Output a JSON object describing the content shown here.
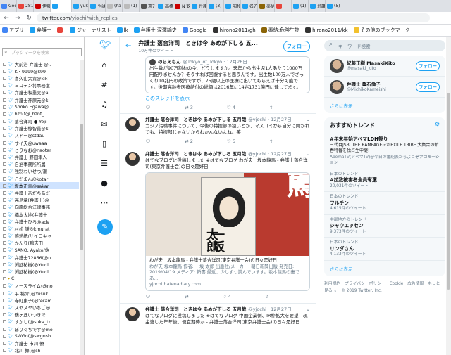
{
  "tabs": [
    {
      "label": "Goo",
      "color": "#4285f4"
    },
    {
      "label": "281",
      "color": "#e8453c"
    },
    {
      "label": "伊藤",
      "color": "#cc0000"
    },
    {
      "label": "",
      "color": "#1da1f2"
    },
    {
      "label": "yuk",
      "color": "#1da1f2"
    },
    {
      "label": "やは",
      "color": "#1da1f2"
    },
    {
      "label": "(ha",
      "color": "#bbb"
    },
    {
      "label": "(1)",
      "color": "#bbb"
    },
    {
      "label": "京7",
      "color": "#555"
    },
    {
      "label": "高橋",
      "color": "#1da1f2"
    },
    {
      "label": "N 飲食",
      "color": "#cc0000"
    },
    {
      "label": "弁護",
      "color": "#1da1f2"
    },
    {
      "label": "(3)",
      "color": "#1da1f2"
    },
    {
      "label": "昭和",
      "color": "#1da1f2"
    },
    {
      "label": "名方",
      "color": "#1da1f2"
    },
    {
      "label": "奉納",
      "color": "#8b6508"
    },
    {
      "label": "",
      "color": "#e8453c"
    },
    {
      "label": "(1)",
      "color": "#1da1f2"
    },
    {
      "label": "弁護",
      "color": "#1da1f2"
    },
    {
      "label": "(5)",
      "color": "#1da1f2"
    }
  ],
  "address": {
    "host": "twitter.com",
    "path": "/yjochi/with_replies"
  },
  "bookmarks": [
    {
      "label": "アプリ",
      "color": "#4285f4"
    },
    {
      "label": "弁護士",
      "color": "#1da1f2"
    },
    {
      "label": "",
      "color": "#e8453c"
    },
    {
      "label": "ジャーナリスト",
      "color": "#1da1f2"
    },
    {
      "label": "lk",
      "color": "#1da1f2"
    },
    {
      "label": "弁護士 深澤諭史",
      "color": "#1da1f2"
    },
    {
      "label": "Google",
      "color": "#4285f4"
    },
    {
      "label": "hirono2011/gh",
      "color": "#333"
    },
    {
      "label": "奉納:危険生物",
      "color": "#8b6508"
    },
    {
      "label": "hirono2011/kk",
      "color": "#333"
    },
    {
      "label": "その他のブックマーク",
      "color": "#f2c12e"
    }
  ],
  "sidebar": {
    "search_placeholder": "ブックマークを検索",
    "items": [
      {
        "label": "大前治 弁護士 @..",
        "sel": false,
        "folder": false
      },
      {
        "label": "K・9999@k99",
        "sel": false,
        "folder": false
      },
      {
        "label": "喜久山大貴@kik",
        "sel": false,
        "folder": false
      },
      {
        "label": "ヨコテン将事務室",
        "sel": false,
        "folder": false
      },
      {
        "label": "弁護士和重実@a",
        "sel": false,
        "folder": false
      },
      {
        "label": "弁護士神原元@k",
        "sel": false,
        "folder": false
      },
      {
        "label": "Shoko Egawa@",
        "sel": false,
        "folder": false
      },
      {
        "label": "hzn f@_hznf_",
        "sel": false,
        "folder": false
      },
      {
        "label": "落合洋司 ● Yoji",
        "sel": false,
        "folder": false
      },
      {
        "label": "弁護士楾智貫@k",
        "sel": false,
        "folder": false
      },
      {
        "label": "スドー@stdau",
        "sel": false,
        "folder": false
      },
      {
        "label": "サイ夫@uwaaa",
        "sel": false,
        "folder": false
      },
      {
        "label": "とりなお@naotar",
        "sel": false,
        "folder": false
      },
      {
        "label": "弁護士 野田隼人",
        "sel": false,
        "folder": false
      },
      {
        "label": "自治事務所所属",
        "sel": false,
        "folder": false
      },
      {
        "label": "強制わいせつ/漸",
        "sel": false,
        "folder": false
      },
      {
        "label": "こだまん@kotar",
        "sel": false,
        "folder": false
      },
      {
        "label": "坂本正幸@sakar",
        "sel": true,
        "folder": false
      },
      {
        "label": "弁護士あだちあだ",
        "sel": false,
        "folder": false
      },
      {
        "label": "高島章(弁護士)@",
        "sel": false,
        "folder": false
      },
      {
        "label": "向原総合法律事務",
        "sel": false,
        "folder": false
      },
      {
        "label": "橋本太地(弁護士",
        "sel": false,
        "folder": false
      },
      {
        "label": "弁護士ひろ@adv",
        "sel": false,
        "folder": false
      },
      {
        "label": "村松 謙@kmurat",
        "sel": false,
        "folder": false
      },
      {
        "label": "感熱紙/サイコキャ",
        "sel": false,
        "folder": false
      },
      {
        "label": "かんり(鴨志田",
        "sel": false,
        "folder": false
      },
      {
        "label": "SANO, Ayako/佐",
        "sel": false,
        "folder": false
      },
      {
        "label": "弁護士72866(@n",
        "sel": false,
        "folder": false
      },
      {
        "label": "渕延祐樹(@Yukil",
        "sel": false,
        "folder": false
      },
      {
        "label": "渕延祐樹(@Yukil",
        "sel": false,
        "folder": false
      },
      {
        "label": "C",
        "sel": false,
        "folder": true
      },
      {
        "label": "ノースライム(@no",
        "sel": false,
        "folder": false
      },
      {
        "label": "平 裕介(@Yusuk",
        "sel": false,
        "folder": false
      },
      {
        "label": "寺町東子(@teram",
        "sel": false,
        "folder": false
      },
      {
        "label": "スヤスヤいちご@",
        "sel": false,
        "folder": false
      },
      {
        "label": "鶴ヶ丘いつきで",
        "sel": false,
        "folder": false
      },
      {
        "label": "すかし(@suka_t)",
        "sel": false,
        "folder": false
      },
      {
        "label": "ぼりぐちです@mo",
        "sel": false,
        "folder": false
      },
      {
        "label": "SWGo(@swgnsb",
        "sel": false,
        "folder": false
      },
      {
        "label": "弁護士 市川 僚",
        "sel": false,
        "folder": false
      },
      {
        "label": "北川 舞(@sh",
        "sel": false,
        "folder": false
      }
    ]
  },
  "header": {
    "title": "弁護士 落合洋司　ときは今 あめが下しる 五...",
    "subtitle": "10万件のツイート",
    "follow_label": "フォロー"
  },
  "quote_tweet": {
    "name": "のらえもん",
    "handle": "@Tokyo_of_Tokyo · 12月26日",
    "text": "出生数が90万割れの今、どうしますか。来年から出生児1人あたり1000万円配りませんか？そうすれば回復すると思うんです。出生数100万人でざっくり10兆円の政策ですが、75歳以上の医療に出いてもらえば十分可能です。後期高齢者医療給付の総額は2016年に14兆1731億円に達してます。",
    "thread_link": "このスレッドを表示",
    "reply": "",
    "retweets": "3",
    "likes": "4"
  },
  "tweets": [
    {
      "name": "弁護士 落合洋司　ときは今 あめが下しる 五月哉",
      "handle": "@yjochi · 12月27日",
      "text": "カジノ汚職事件について、今後の特捜部の狙いとか、マスコミから自分に聞かれても、特捜部じゃないからわかんないよね。笑",
      "reply": "",
      "retweets": "2",
      "likes": "5"
    },
    {
      "name": "弁護士 落合洋司　ときは今 あめが下しる 五月哉",
      "handle": "@yjochi · 12月27日",
      "text": "はてなブログに投稿しました #はてなブログ わが夫　坂本龍馬 - 弁護士落合洋司(東京弁護士会)の日々是好日",
      "card_title": "わが夫　坂本龍馬 - 弁護士落合洋司(東京弁護士会)の日々是好日",
      "card_desc": "わが夫 坂本龍馬 作者: 一坂 太郎 出版社/メーカー: 朝日新聞出版 発売日: 2019/04/19 メディア: 新書 最近、少しずつ読んでいます。坂本龍馬の妻であ...",
      "card_domain": "yjochi.hatenadiary.com",
      "cover_title": "一坂太郎",
      "cover_char": "龍馬",
      "reply": "",
      "retweets": "",
      "likes": "4"
    },
    {
      "name": "弁護士 落合洋司　ときは今 あめが下しる 五月哉",
      "handle": "@yjochi · 12月27日",
      "text": "はてなブログに投稿しました #はてなブログ 中国企業側、IR枠拡大を要望　現金渡した年年後、便宜期待か - 弁護士落合洋司(東京弁護士会)の日々是好日"
    }
  ],
  "right": {
    "search_placeholder": "キーワード検索",
    "people": [
      {
        "name": "紀藤正樹 MasakiKito",
        "handle": "@masaki_kito",
        "follow": "フォロー"
      },
      {
        "name": "弁護士 亀石倫子",
        "handle": "@MichikoKameishi",
        "follow": "フォロー"
      }
    ],
    "more": "さらに表示",
    "trends_title": "おすすめトレンド",
    "trends": [
      {
        "cat": "",
        "title": "#年末年始アベマLDH祭り",
        "desc": "三代目JSB, THE RAMPAGEほかEXILE TRIBE 大集合の新春特番を独占生中継!",
        "count": "AbemaTV(アベマTV)@今日の番組表からよこぞプロモーション"
      },
      {
        "cat": "日本のトレンド",
        "title": "#拉致被害者全員奪還",
        "desc": "",
        "count": "20,031件のツイート"
      },
      {
        "cat": "日本のトレンド",
        "title": "フルチン",
        "desc": "",
        "count": "4,615件のツイート"
      },
      {
        "cat": "中部地方のトレンド",
        "title": "シャウエッセン",
        "desc": "",
        "count": "9,373件のツイート"
      },
      {
        "cat": "日本のトレンド",
        "title": "リンダさん",
        "desc": "",
        "count": "4,133件のツイート"
      }
    ],
    "trends_more": "さらに表示",
    "footer": "利用規約　プライバシーポリシー　Cookie　広告情報　もっと見る ⌄　© 2019 Twitter, Inc."
  }
}
